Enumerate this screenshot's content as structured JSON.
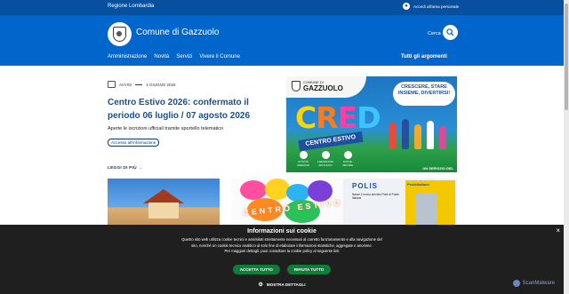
{
  "topbar": {
    "region": "Regione Lombardia",
    "access_label": "Accedi all'area personale"
  },
  "header": {
    "site_title": "Comune di Gazzuolo",
    "search_label": "Cerca",
    "nav": [
      "Amministrazione",
      "Novità",
      "Servizi",
      "Vivere il Comune"
    ],
    "all_topics": "Tutti gli argomenti"
  },
  "news": {
    "category": "AVVISI",
    "date": "4 GIUGNO 2026",
    "title": "Centro Estivo 2026: confermato il periodo 06 luglio / 07 agosto 2026",
    "description": "Aperte le iscrizioni ufficiali tramite sportello telematico",
    "tag": "Accesso all'informazione",
    "read_more": "LEGGI DI PIÙ →"
  },
  "hero": {
    "comune": "COMUNE DI",
    "gazzuolo": "GAZZUOLO",
    "bubble": "CRESCERE, STARE INSIEME, DIVERTIRSI!",
    "cred_letters": [
      "C",
      "R",
      "E",
      "D"
    ],
    "banner": "CENTRO ESTIVO",
    "services": [
      "ATTIVITÀ CREATIVE",
      "LABORATORI EDUCATIVI",
      "NUOVE AMICIZIE"
    ],
    "footer": "UN SERVIZIO DEL"
  },
  "cards": {
    "card2_word": [
      "C",
      "E",
      "N",
      "T",
      "R",
      "O",
      " ",
      "E",
      "S",
      "T",
      "I",
      "V",
      "O"
    ],
    "card3_title": "POLIS",
    "card3_text": "Nasce il nuovo servizio Polis di Poste Italiane",
    "card3_sign": "Posteitaliane"
  },
  "cookie": {
    "close": "×",
    "title": "Informazioni sui cookie",
    "body": "Questo sito web utilizza cookie tecnici e assimilati strettamente necessari al corretto funzionamento e alla navigazione del sito, nonché un cookie tecnico analitico al solo fine di elaborare informazioni statistiche, aggregate e anonime.",
    "body2": "Per maggiori dettagli, puoi consultare la cookie policy al seguente link",
    "accept": "ACCETTA TUTTO",
    "reject": "RIFIUTA TUTTO",
    "details": "MOSTRA DETTAGLI"
  },
  "watermark": "ScanMalware"
}
